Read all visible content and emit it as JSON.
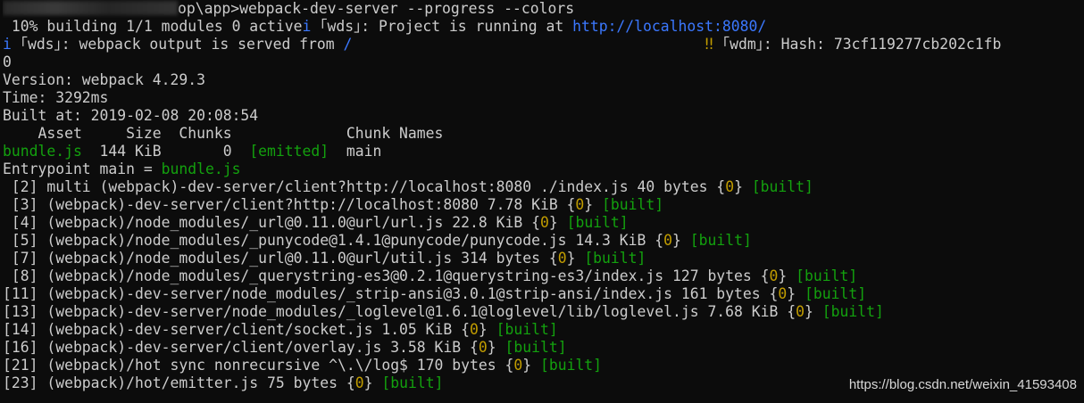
{
  "colors": {
    "background": "#0c0c0c",
    "text": "#cccccc",
    "green": "#13a10e",
    "blue": "#3b78ff",
    "yellow": "#c19c00"
  },
  "lines": [
    [
      {
        "t": "blur"
      },
      {
        "t": "op\\app>webpack-dev-server --progress --colors",
        "c": "w"
      }
    ],
    [
      {
        "t": " 10% building 1/1 modules 0 active",
        "c": "w"
      },
      {
        "t": "i ",
        "c": "b"
      },
      {
        "t": "｢wds｣: Project is running at ",
        "c": "w"
      },
      {
        "t": "http://localhost:8080/",
        "c": "b"
      }
    ],
    [
      {
        "t": "i ",
        "c": "b"
      },
      {
        "t": "｢wds｣: webpack output is served from ",
        "c": "w"
      },
      {
        "t": "/",
        "c": "b"
      },
      {
        "t": "                                        ",
        "c": "w"
      },
      {
        "t": "‼ ",
        "c": "y"
      },
      {
        "t": "｢wdm｣: Hash: 73cf119277cb202c1fb",
        "c": "w"
      }
    ],
    [
      {
        "t": "0",
        "c": "w"
      }
    ],
    [
      {
        "t": "Version: webpack 4.29.3",
        "c": "w"
      }
    ],
    [
      {
        "t": "Time: 3292ms",
        "c": "w"
      }
    ],
    [
      {
        "t": "Built at: 2019-02-08 20:08:54",
        "c": "w"
      }
    ],
    [
      {
        "t": "    Asset     Size  Chunks             Chunk Names",
        "c": "w"
      }
    ],
    [
      {
        "t": "bundle.js",
        "c": "g"
      },
      {
        "t": "  144 KiB       0  ",
        "c": "w"
      },
      {
        "t": "[emitted]",
        "c": "g"
      },
      {
        "t": "  main",
        "c": "w"
      }
    ],
    [
      {
        "t": "Entrypoint main = ",
        "c": "w"
      },
      {
        "t": "bundle.js",
        "c": "g"
      }
    ],
    [
      {
        "t": " [2] multi (webpack)-dev-server/client?http://localhost:8080 ./index.js 40 bytes {",
        "c": "w"
      },
      {
        "t": "0",
        "c": "y"
      },
      {
        "t": "} ",
        "c": "w"
      },
      {
        "t": "[built]",
        "c": "g"
      }
    ],
    [
      {
        "t": " [3] (webpack)-dev-server/client?http://localhost:8080 7.78 KiB {",
        "c": "w"
      },
      {
        "t": "0",
        "c": "y"
      },
      {
        "t": "} ",
        "c": "w"
      },
      {
        "t": "[built]",
        "c": "g"
      }
    ],
    [
      {
        "t": " [4] (webpack)/node_modules/_url@0.11.0@url/url.js 22.8 KiB {",
        "c": "w"
      },
      {
        "t": "0",
        "c": "y"
      },
      {
        "t": "} ",
        "c": "w"
      },
      {
        "t": "[built]",
        "c": "g"
      }
    ],
    [
      {
        "t": " [5] (webpack)/node_modules/_punycode@1.4.1@punycode/punycode.js 14.3 KiB {",
        "c": "w"
      },
      {
        "t": "0",
        "c": "y"
      },
      {
        "t": "} ",
        "c": "w"
      },
      {
        "t": "[built]",
        "c": "g"
      }
    ],
    [
      {
        "t": " [7] (webpack)/node_modules/_url@0.11.0@url/util.js 314 bytes {",
        "c": "w"
      },
      {
        "t": "0",
        "c": "y"
      },
      {
        "t": "} ",
        "c": "w"
      },
      {
        "t": "[built]",
        "c": "g"
      }
    ],
    [
      {
        "t": " [8] (webpack)/node_modules/_querystring-es3@0.2.1@querystring-es3/index.js 127 bytes {",
        "c": "w"
      },
      {
        "t": "0",
        "c": "y"
      },
      {
        "t": "} ",
        "c": "w"
      },
      {
        "t": "[built]",
        "c": "g"
      }
    ],
    [
      {
        "t": "[11] (webpack)-dev-server/node_modules/_strip-ansi@3.0.1@strip-ansi/index.js 161 bytes {",
        "c": "w"
      },
      {
        "t": "0",
        "c": "y"
      },
      {
        "t": "} ",
        "c": "w"
      },
      {
        "t": "[built]",
        "c": "g"
      }
    ],
    [
      {
        "t": "[13] (webpack)-dev-server/node_modules/_loglevel@1.6.1@loglevel/lib/loglevel.js 7.68 KiB {",
        "c": "w"
      },
      {
        "t": "0",
        "c": "y"
      },
      {
        "t": "} ",
        "c": "w"
      },
      {
        "t": "[built]",
        "c": "g"
      }
    ],
    [
      {
        "t": "[14] (webpack)-dev-server/client/socket.js 1.05 KiB {",
        "c": "w"
      },
      {
        "t": "0",
        "c": "y"
      },
      {
        "t": "} ",
        "c": "w"
      },
      {
        "t": "[built]",
        "c": "g"
      }
    ],
    [
      {
        "t": "[16] (webpack)-dev-server/client/overlay.js 3.58 KiB {",
        "c": "w"
      },
      {
        "t": "0",
        "c": "y"
      },
      {
        "t": "} ",
        "c": "w"
      },
      {
        "t": "[built]",
        "c": "g"
      }
    ],
    [
      {
        "t": "[21] (webpack)/hot sync nonrecursive ^\\.\\/log$ 170 bytes {",
        "c": "w"
      },
      {
        "t": "0",
        "c": "y"
      },
      {
        "t": "} ",
        "c": "w"
      },
      {
        "t": "[built]",
        "c": "g"
      }
    ],
    [
      {
        "t": "[23] (webpack)/hot/emitter.js 75 bytes {",
        "c": "w"
      },
      {
        "t": "0",
        "c": "y"
      },
      {
        "t": "} ",
        "c": "w"
      },
      {
        "t": "[built]",
        "c": "g"
      }
    ]
  ],
  "watermark": "https://blog.csdn.net/weixin_41593408"
}
